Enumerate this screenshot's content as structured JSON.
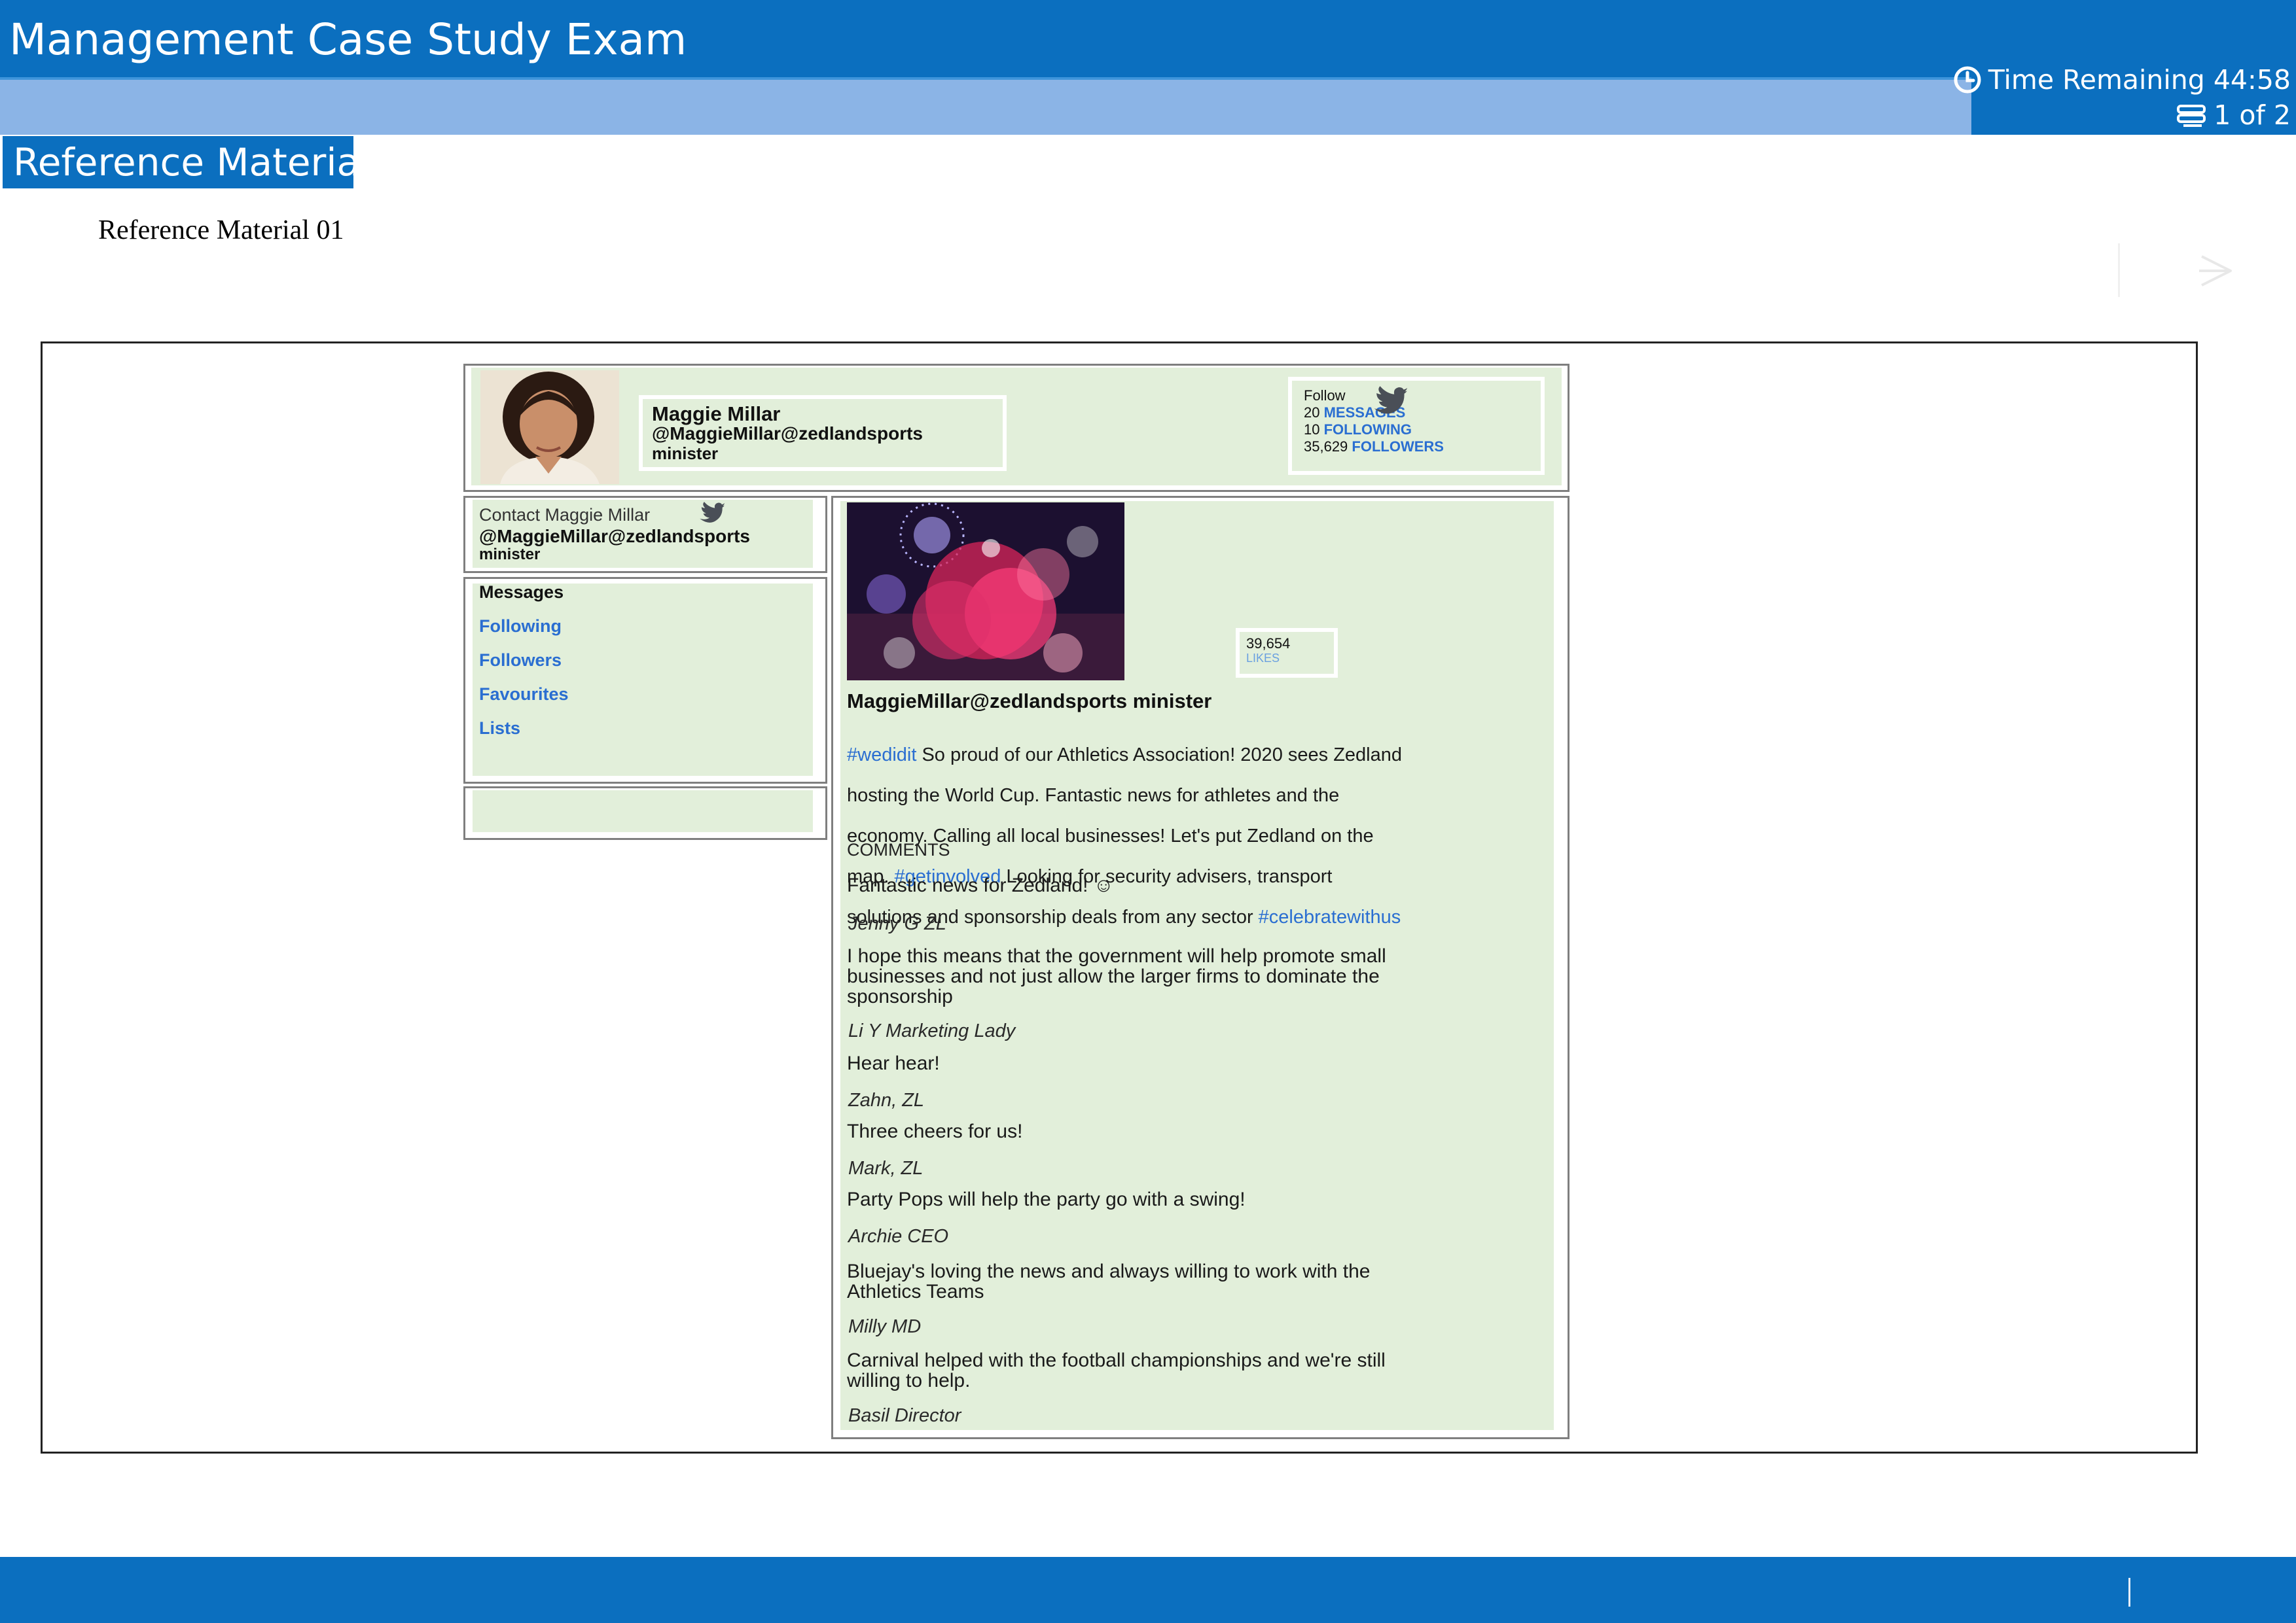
{
  "header": {
    "title": "Management Case Study Exam",
    "time_remaining": "Time Remaining 44:58",
    "page_indicator": "1 of 2"
  },
  "reference": {
    "tab_label": "Reference Material",
    "subtitle": "Reference Material 01"
  },
  "profile": {
    "name": "Maggie Millar",
    "handle": "@MaggieMillar@zedlandsports",
    "role": "minister",
    "follow_label": "Follow",
    "messages_count": "20",
    "messages_label": "MESSAGES",
    "following_count": "10",
    "following_label": "FOLLOWING",
    "followers_count": "35,629",
    "followers_label": "FOLLOWERS"
  },
  "contact": {
    "title": "Contact Maggie Millar",
    "handle": "@MaggieMillar@zedlandsports",
    "role": "minister"
  },
  "menu": [
    "Messages",
    "Following",
    "Followers",
    "Favourites",
    "Lists"
  ],
  "post": {
    "likes_count": "39,654",
    "likes_label": "LIKES",
    "author": "MaggieMillar@zedlandsports minister",
    "body": [
      {
        "tag": "#wedidit",
        "text": " So proud of our Athletics Association! 2020 sees Zedland"
      },
      {
        "tag": "",
        "text": "hosting the World Cup. Fantastic news for athletes and the"
      },
      {
        "tag": "",
        "text": "economy. Calling all local businesses! Let's put Zedland on the"
      },
      {
        "tag": "",
        "text": "map. ",
        "tag2": "#getinvolved",
        "text2": " Looking for security advisers, transport"
      },
      {
        "tag": "",
        "text": "solutions and sponsorship deals from any sector ",
        "tag2": "#celebratewithus"
      }
    ],
    "comments_heading": "COMMENTS",
    "comments": [
      {
        "text": "Fantastic news for Zedland! ☺",
        "author": "Jenny G ZL"
      },
      {
        "text": "I hope this means that the government will help promote small\nbusinesses and not just allow the larger firms to dominate the\nsponsorship",
        "author": "Li Y Marketing Lady"
      },
      {
        "text": "Hear hear!",
        "author": "Zahn, ZL"
      },
      {
        "text": "Three cheers for us!",
        "author": "Mark, ZL"
      },
      {
        "text": "Party Pops will help the party go with a swing!",
        "author": "Archie CEO"
      },
      {
        "text": "Bluejay's loving the news and always willing to work with the\nAthletics Teams",
        "author": "Milly MD"
      },
      {
        "text": "Carnival helped with the football championships and we're still\nwilling to help.",
        "author": "Basil Director"
      }
    ]
  },
  "colors": {
    "brand_blue": "#0b6fbf",
    "light_blue_bar": "#8bb4e6",
    "panel_green": "#e2efda",
    "link_blue": "#2a6ed1"
  }
}
